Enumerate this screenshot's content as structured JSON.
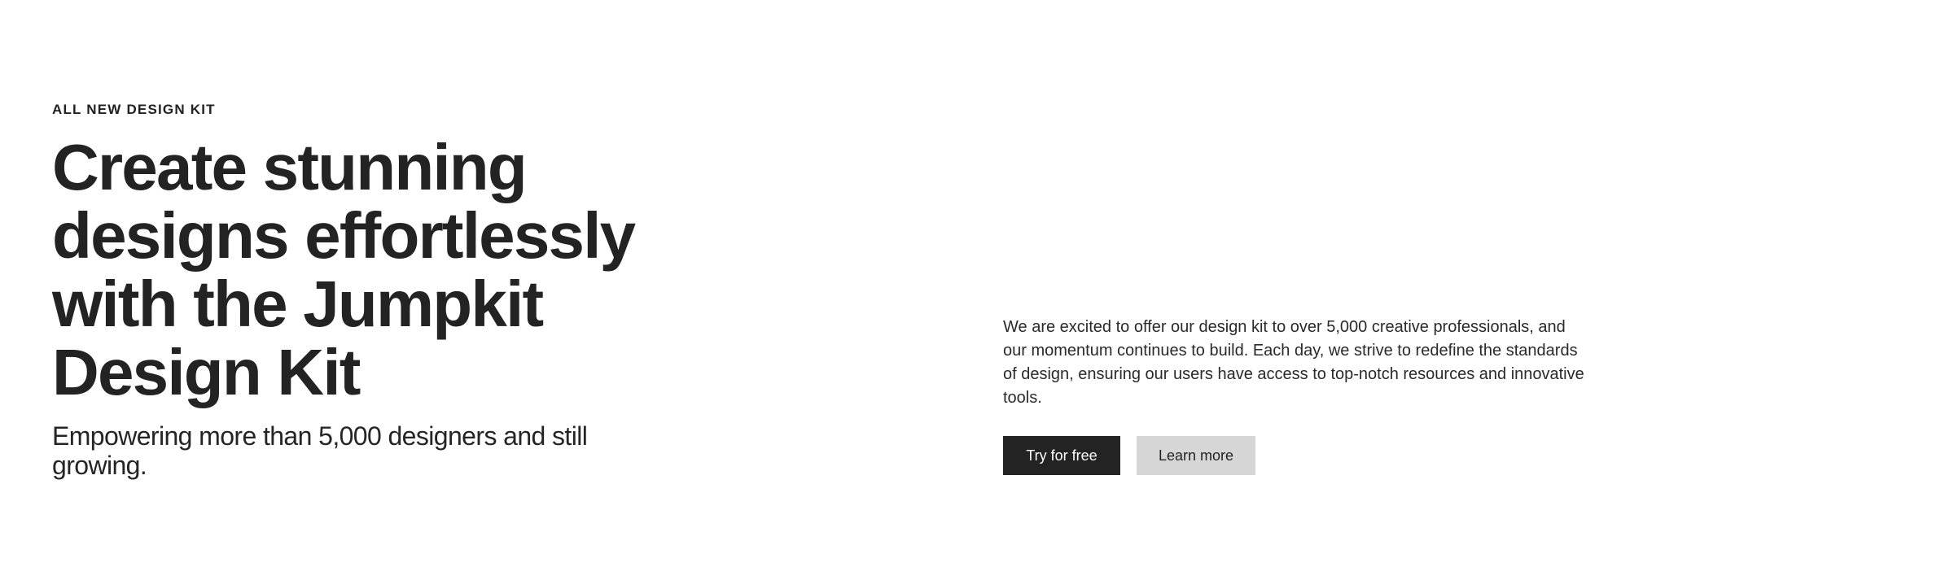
{
  "hero": {
    "eyebrow": "ALL NEW DESIGN KIT",
    "headline": "Create stunning designs effortlessly with the Jumpkit Design Kit",
    "subhead": "Empowering more than 5,000 designers and still growing.",
    "body": "We are excited to offer our design kit to over 5,000 creative professionals, and our momentum continues to build. Each day, we strive to redefine the standards of design, ensuring our users have access to top-notch resources and innovative tools.",
    "primary_button": "Try for free",
    "secondary_button": "Learn more"
  },
  "colors": {
    "text": "#252525",
    "primary_button_bg": "#232323",
    "secondary_button_bg": "#d6d6d6",
    "background": "#ffffff"
  }
}
